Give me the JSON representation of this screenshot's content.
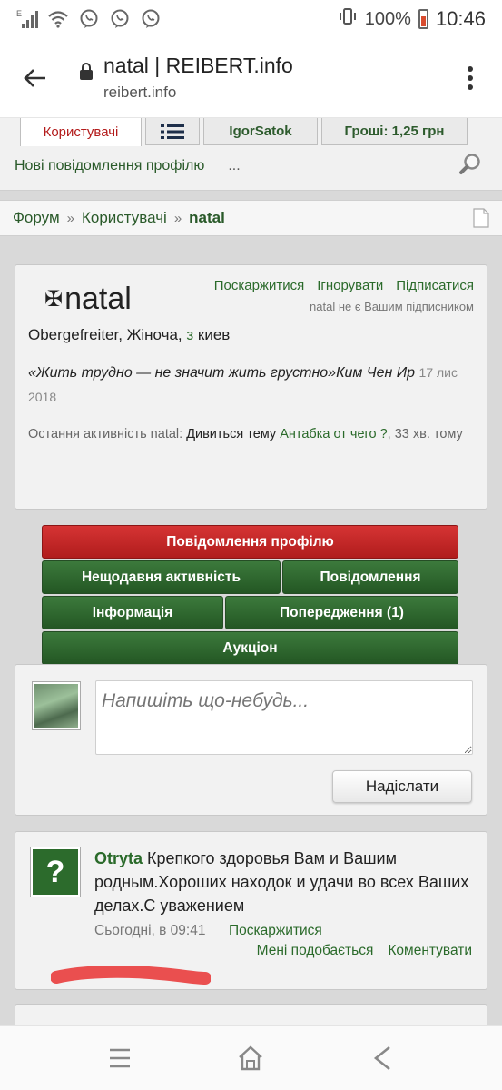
{
  "status_bar": {
    "network": "E",
    "battery_percent": "100%",
    "time": "10:46"
  },
  "browser": {
    "page_title": "natal | REIBERT.info",
    "domain": "reibert.info"
  },
  "site_nav": {
    "tabs": [
      {
        "label": "Користувачі",
        "active": true
      },
      {
        "label": "☰",
        "active": false
      },
      {
        "label": "IgorSatok",
        "active": false
      },
      {
        "label": "Гроші: 1,25 грн",
        "active": false
      }
    ],
    "sub_link": "Нові повідомлення профілю",
    "sub_more": "..."
  },
  "breadcrumb": {
    "items": [
      "Форум",
      "Користувачі"
    ],
    "separator": "»",
    "current": "natal"
  },
  "profile": {
    "username": "natal",
    "actions": [
      "Поскаржитися",
      "Ігнорувати",
      "Підписатися"
    ],
    "subscribe_note": "natal не є Вашим підписником",
    "info_prefix": "Obergefreiter, Жіноча, ",
    "info_link": "з",
    "info_city": " киев",
    "quote": "«Жить трудно — не значит жить грустно»Ким Чен Ир",
    "quote_date": "17 лис 2018",
    "last_activity_label": "Остання активність natal: ",
    "last_activity_action": "Дивиться тему ",
    "last_activity_topic": "Антабка от чего ?",
    "last_activity_time": ", 33 хв. тому"
  },
  "profile_tabs": {
    "messages": "Повідомлення профілю",
    "recent": "Нещодавня активність",
    "posts": "Повідомлення",
    "info": "Інформація",
    "warnings": "Попередження (1)",
    "auction": "Аукціон"
  },
  "post_box": {
    "placeholder": "Напишіть що-небудь...",
    "send_label": "Надіслати"
  },
  "message": {
    "author": "Otryta",
    "text": " Крепкого здоровья Вам и Вашим родным.Хороших находок и удачи во всех Ваших делах.С уважением",
    "time": "Сьогодні, в 09:41",
    "report": "Поскаржитися",
    "like": "Мені подобається",
    "comment": "Коментувати"
  },
  "colors": {
    "accent_green": "#2a6a2a",
    "active_tab_red": "#b31b1b",
    "scribble_red": "#ea4f4f"
  }
}
